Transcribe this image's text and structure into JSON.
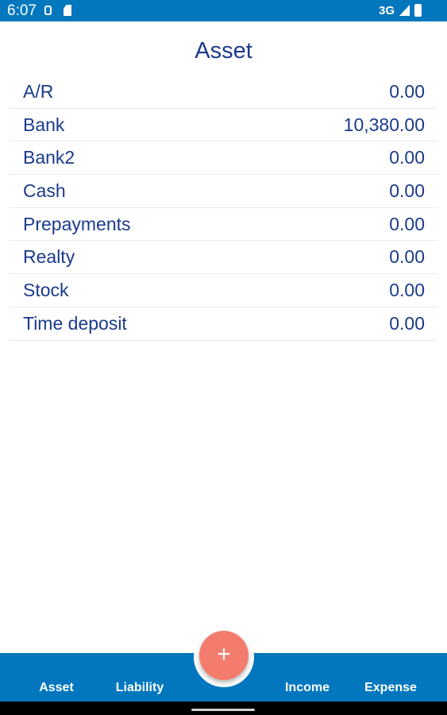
{
  "status_bar": {
    "time": "6:07",
    "network": "3G",
    "icons": [
      "s-icon",
      "sd-card-icon",
      "signal-icon",
      "battery-icon"
    ]
  },
  "page": {
    "title": "Asset"
  },
  "accounts": [
    {
      "name": "A/R",
      "amount": "0.00"
    },
    {
      "name": "Bank",
      "amount": "10,380.00"
    },
    {
      "name": "Bank2",
      "amount": "0.00"
    },
    {
      "name": "Cash",
      "amount": "0.00"
    },
    {
      "name": "Prepayments",
      "amount": "0.00"
    },
    {
      "name": "Realty",
      "amount": "0.00"
    },
    {
      "name": "Stock",
      "amount": "0.00"
    },
    {
      "name": "Time deposit",
      "amount": "0.00"
    }
  ],
  "fab": {
    "label": "+"
  },
  "nav": {
    "asset": "Asset",
    "liability": "Liability",
    "income": "Income",
    "expense": "Expense"
  },
  "colors": {
    "primary": "#0277bd",
    "text": "#1a3a8c",
    "fab": "#f47c6c"
  }
}
